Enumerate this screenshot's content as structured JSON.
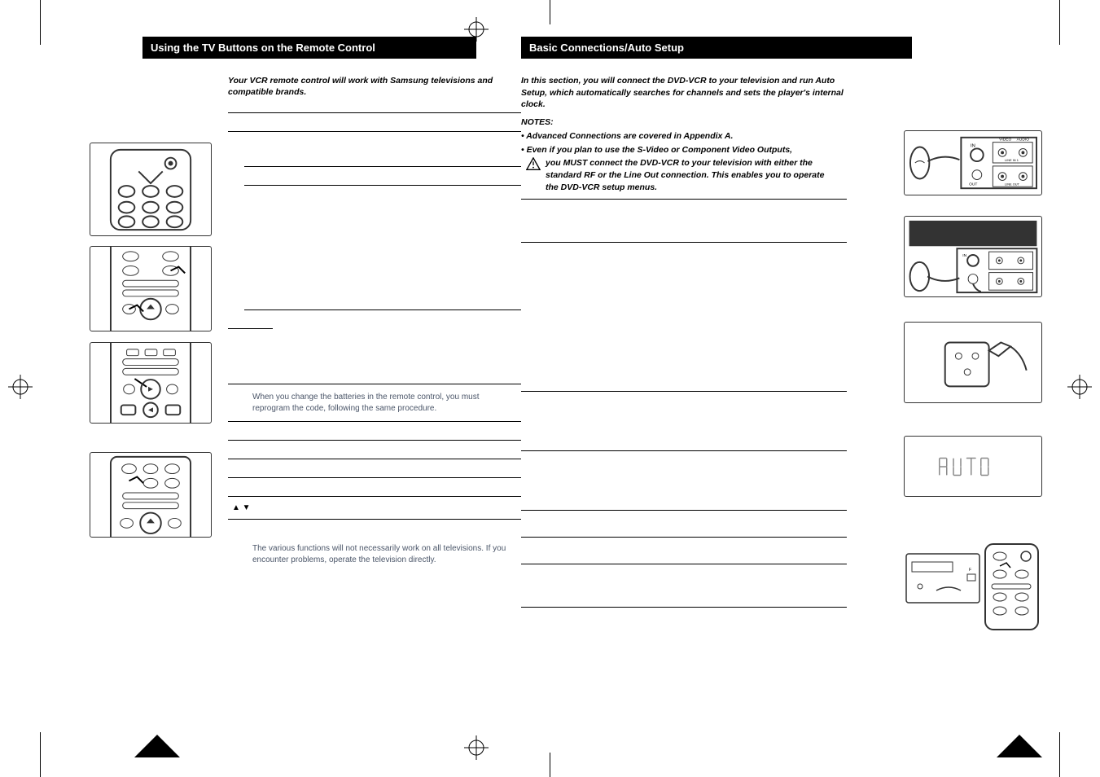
{
  "left": {
    "header": "Using the TV Buttons on the Remote Control",
    "intro": "Your VCR remote control will work with Samsung televisions and compatible brands.",
    "note_battery": "When you change the batteries in the remote control, you must reprogram the code, following the same procedure.",
    "arrows": "▲   ▼",
    "note_functions": "The various functions will not necessarily work on all televisions. If you encounter problems, operate the television directly."
  },
  "right": {
    "header": "Basic Connections/Auto Setup",
    "intro": "In this section, you will connect the DVD-VCR to your television and run Auto Setup, which automatically searches for channels and sets the player's internal clock.",
    "notes_label": "NOTES:",
    "note1": "• Advanced Connections are covered in Appendix A.",
    "note2": "• Even if you plan to use the S-Video or Component Video Outputs,",
    "note2b": "you MUST connect the DVD-VCR to your television with either the standard RF or the Line Out connection. This enables you to operate the DVD-VCR setup menus.",
    "display_text": "AUTO"
  }
}
